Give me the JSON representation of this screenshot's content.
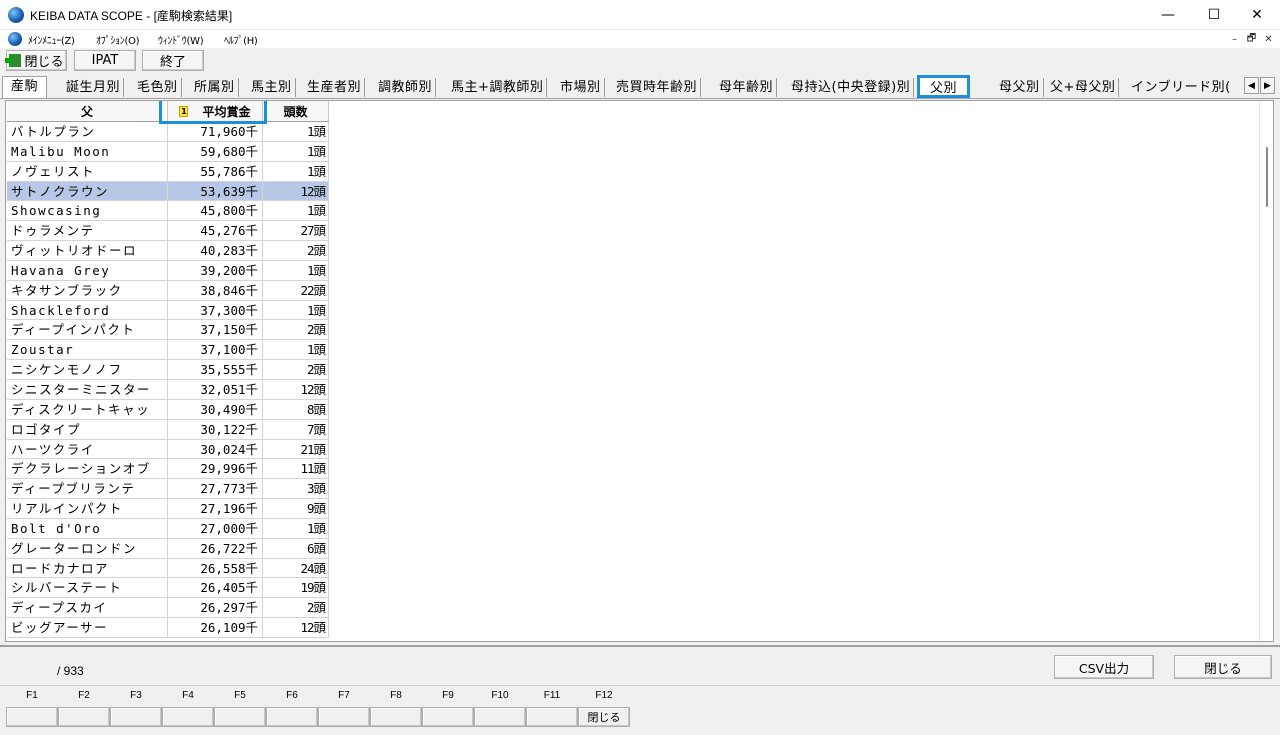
{
  "window": {
    "title": "KEIBA DATA SCOPE - [産駒検索結果]",
    "minimize": "—",
    "maximize": "☐",
    "close": "✕",
    "icon": "globe-icon"
  },
  "menu": {
    "items": [
      "ﾒｲﾝﾒﾆｭｰ(Z)",
      "ｵﾌﾟｼｮﾝ(O)",
      "ｳｨﾝﾄﾞｳ(W)",
      "ﾍﾙﾌﾟ(H)"
    ],
    "mdi_controls": [
      "–",
      "🗗",
      "✕"
    ]
  },
  "toolbar": {
    "close_label": "閉じる",
    "ipat_label": "IPAT",
    "exit_label": "終了"
  },
  "tabs": {
    "items": [
      "産駒",
      "誕生月別",
      "毛色別",
      "所属別",
      "馬主別",
      "生産者別",
      "調教師別",
      "馬主+調教師別",
      "市場別",
      "売買時年齢別",
      "母年齢別",
      "母持込(中央登録)別",
      "父別",
      "母父別",
      "父+母父別",
      "インブリード別("
    ],
    "selected": "父別",
    "scroll_left": "◀",
    "scroll_right": "▶"
  },
  "grid": {
    "headers": {
      "name": "父",
      "prize": "平均賞金",
      "count": "頭数",
      "sort_rank": "1"
    },
    "rows": [
      {
        "name": "バトルプラン",
        "prize": "71,960千",
        "count": "1頭"
      },
      {
        "name": "Malibu Moon",
        "prize": "59,680千",
        "count": "1頭"
      },
      {
        "name": "ノヴェリスト",
        "prize": "55,786千",
        "count": "1頭"
      },
      {
        "name": "サトノクラウン",
        "prize": "53,639千",
        "count": "12頭"
      },
      {
        "name": "Showcasing",
        "prize": "45,800千",
        "count": "1頭"
      },
      {
        "name": "ドゥラメンテ",
        "prize": "45,276千",
        "count": "27頭"
      },
      {
        "name": "ヴィットリオドーロ",
        "prize": "40,283千",
        "count": "2頭"
      },
      {
        "name": "Havana Grey",
        "prize": "39,200千",
        "count": "1頭"
      },
      {
        "name": "キタサンブラック",
        "prize": "38,846千",
        "count": "22頭"
      },
      {
        "name": "Shackleford",
        "prize": "37,300千",
        "count": "1頭"
      },
      {
        "name": "ディープインパクト",
        "prize": "37,150千",
        "count": "2頭"
      },
      {
        "name": "Zoustar",
        "prize": "37,100千",
        "count": "1頭"
      },
      {
        "name": "ニシケンモノノフ",
        "prize": "35,555千",
        "count": "2頭"
      },
      {
        "name": "シニスターミニスター",
        "prize": "32,051千",
        "count": "12頭"
      },
      {
        "name": "ディスクリートキャッ",
        "prize": "30,490千",
        "count": "8頭"
      },
      {
        "name": "ロゴタイプ",
        "prize": "30,122千",
        "count": "7頭"
      },
      {
        "name": "ハーツクライ",
        "prize": "30,024千",
        "count": "21頭"
      },
      {
        "name": "デクラレーションオブ",
        "prize": "29,996千",
        "count": "11頭"
      },
      {
        "name": "ディープブリランテ",
        "prize": "27,773千",
        "count": "3頭"
      },
      {
        "name": "リアルインパクト",
        "prize": "27,196千",
        "count": "9頭"
      },
      {
        "name": "Bolt d'Oro",
        "prize": "27,000千",
        "count": "1頭"
      },
      {
        "name": "グレーターロンドン",
        "prize": "26,722千",
        "count": "6頭"
      },
      {
        "name": "ロードカナロア",
        "prize": "26,558千",
        "count": "24頭"
      },
      {
        "name": "シルバーステート",
        "prize": "26,405千",
        "count": "19頭"
      },
      {
        "name": "ディープスカイ",
        "prize": "26,297千",
        "count": "2頭"
      },
      {
        "name": "ビッグアーサー",
        "prize": "26,109千",
        "count": "12頭"
      }
    ],
    "selected_row": "サトノクラウン"
  },
  "status": {
    "text": "/   933",
    "csv_label": "CSV出力",
    "close_label": "閉じる"
  },
  "function_keys": {
    "labels": [
      "F1",
      "F2",
      "F3",
      "F4",
      "F5",
      "F6",
      "F7",
      "F8",
      "F9",
      "F10",
      "F11",
      "F12"
    ],
    "actions": [
      "",
      "",
      "",
      "",
      "",
      "",
      "",
      "",
      "",
      "",
      "",
      "閉じる"
    ]
  },
  "colors": {
    "highlight_box": "#1e8fdc",
    "selected_row": "#b7c8e6",
    "sort_badge": "#ffe23a"
  }
}
